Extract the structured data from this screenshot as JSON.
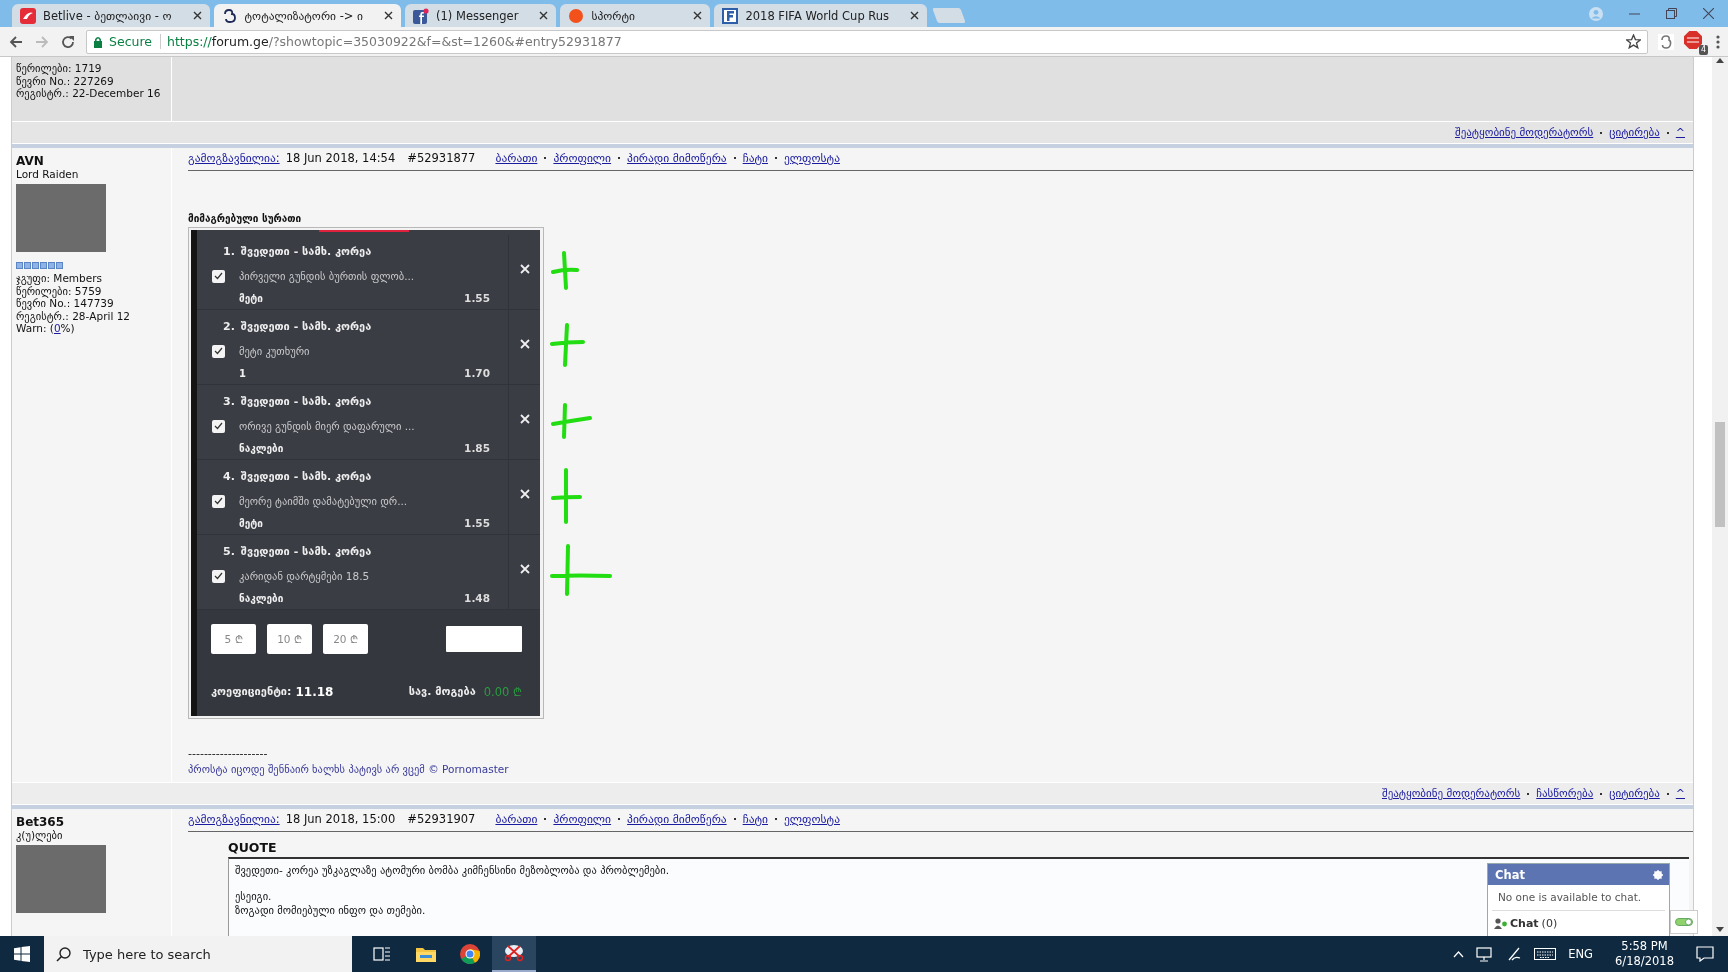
{
  "browser": {
    "tabs": [
      {
        "kind": "betlive",
        "title": "Betlive - ბეთლაივი - ო",
        "selected": false
      },
      {
        "kind": "forum",
        "title": "ტოტალიზატორი -> ი",
        "selected": true
      },
      {
        "kind": "facebook",
        "title": "(1) Messenger",
        "selected": false
      },
      {
        "kind": "dot",
        "title": "სპორტი",
        "selected": false
      },
      {
        "kind": "fifa",
        "title": "2018 FIFA World Cup Rus",
        "selected": false
      }
    ],
    "address_bar": {
      "secure_label": "Secure",
      "url_scheme": "https://",
      "url_host": "forum.ge",
      "url_path": "/?showtopic=35030922&f=&st=1260&#entry52931877"
    },
    "extension_badge": "4"
  },
  "posts": [
    {
      "kind": "partial",
      "profile_lines": [
        "წერილები: 1719",
        "წევრი No.: 227269",
        "რეგისტრ.: 22-December 16"
      ],
      "actions": [
        "შეატყობინე მოდერატორს",
        "ციტირება",
        "^"
      ]
    },
    {
      "kind": "full",
      "author": "AVN",
      "rank": "Lord Raiden",
      "stars": 6,
      "profile_lines": [
        "ჯგუფი: Members",
        "წერილები: 5759",
        "წევრი No.: 147739",
        "რეგისტრ.: 28-April 12"
      ],
      "warn": {
        "prefix": "Warn: (",
        "link": "0",
        "suffix": "%)"
      },
      "header": {
        "sent_label": "გამოგზავნილია:",
        "date": "18 Jun 2018, 14:54",
        "entry": "#52931877",
        "links": [
          "ბარათი",
          "პროფილი",
          "პირადი მიმოწერა",
          "ჩატი",
          "ელფოსტა"
        ]
      },
      "attachment_title": "მიმაგრებული სურათი",
      "bet_slip": {
        "selections": [
          {
            "number": "1.",
            "match": "შვედეთი - სამხ. კორეა",
            "market": "პირველი გუნდის ბურთის ფლობ...",
            "pick": "მეტი",
            "odds": "1.55",
            "checked": true
          },
          {
            "number": "2.",
            "match": "შვედეთი - სამხ. კორეა",
            "market": "მეტი კუთხური",
            "pick": "1",
            "odds": "1.70",
            "checked": true
          },
          {
            "number": "3.",
            "match": "შვედეთი - სამხ. კორეა",
            "market": "ორივე გუნდის მიერ დაფარული ...",
            "pick": "ნაკლები",
            "odds": "1.85",
            "checked": true
          },
          {
            "number": "4.",
            "match": "შვედეთი - სამხ. კორეა",
            "market": "მეორე ტაიმში დამატებული დრ...",
            "pick": "მეტი",
            "odds": "1.55",
            "checked": true
          },
          {
            "number": "5.",
            "match": "შვედეთი - სამხ. კორეა",
            "market": "კარიდან დარტყმები 18.5",
            "pick": "ნაკლები",
            "odds": "1.48",
            "checked": true
          }
        ],
        "stake_buttons": [
          "5 ₾",
          "10 ₾",
          "20 ₾"
        ],
        "odds_label": "კოეფიციენტი:",
        "total_odds": "11.18",
        "win_label": "სავ. მოგება",
        "win_amount": "0.00 ₾"
      },
      "signature": {
        "rule": "--------------------",
        "text": "პროსტა იცოდე შენნაირ ხალხს პატივს არ ვცემ © Pornomaster"
      },
      "actions": [
        "შეატყობინე მოდერატორს",
        "ჩასწორება",
        "ციტირება",
        "^"
      ]
    },
    {
      "kind": "full",
      "author": "Bet365",
      "rank": "კ(უ)ლები",
      "header": {
        "sent_label": "გამოგზავნილია:",
        "date": "18 Jun 2018, 15:00",
        "entry": "#52931907",
        "links": [
          "ბარათი",
          "პროფილი",
          "პირადი მიმოწერა",
          "ჩატი",
          "ელფოსტა"
        ]
      },
      "quote": {
        "label": "QUOTE",
        "paragraphs": [
          [
            "შვედეთი- კორეა უზკაგლაზე ატომური ბომბა კიმჩენსინი მეზობლობა და პრობლემები."
          ],
          [
            "ესეიგი.",
            "ზოგადი მომიებული ინფო და თემები."
          ]
        ]
      }
    }
  ],
  "chat": {
    "title": "Chat",
    "message": "No one is available to chat.",
    "label": "Chat",
    "count": "(0)"
  },
  "taskbar": {
    "search_placeholder": "Type here to search",
    "language": "ENG",
    "time": "5:58 PM",
    "date": "6/18/2018"
  }
}
